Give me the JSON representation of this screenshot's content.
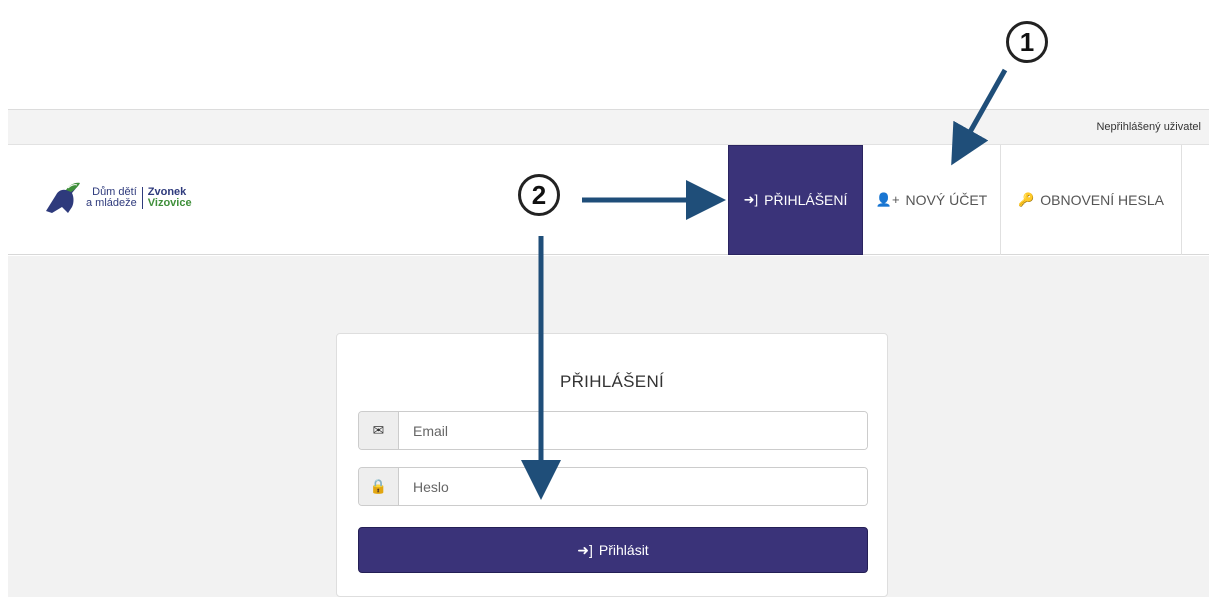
{
  "status_bar": {
    "user_status": "Nepřihlášený uživatel"
  },
  "logo": {
    "line1_left": "Dům dětí",
    "line2_left": "a mládeže",
    "line1_right": "Zvonek",
    "line2_right": "Vizovice"
  },
  "nav": {
    "login": {
      "label": "PŘIHLÁŠENÍ",
      "icon": "sign-in-icon"
    },
    "new_account": {
      "label": "NOVÝ ÚČET",
      "icon": "user-plus-icon"
    },
    "reset_password": {
      "label": "OBNOVENÍ HESLA",
      "icon": "key-icon"
    }
  },
  "login_form": {
    "title": "PŘIHLÁŠENÍ",
    "email_placeholder": "Email",
    "password_placeholder": "Heslo",
    "submit_label": "Přihlásit"
  },
  "annotations": {
    "marker_1": "1",
    "marker_2": "2"
  },
  "colors": {
    "accent": "#3a3379",
    "arrow": "#1f4e79"
  }
}
